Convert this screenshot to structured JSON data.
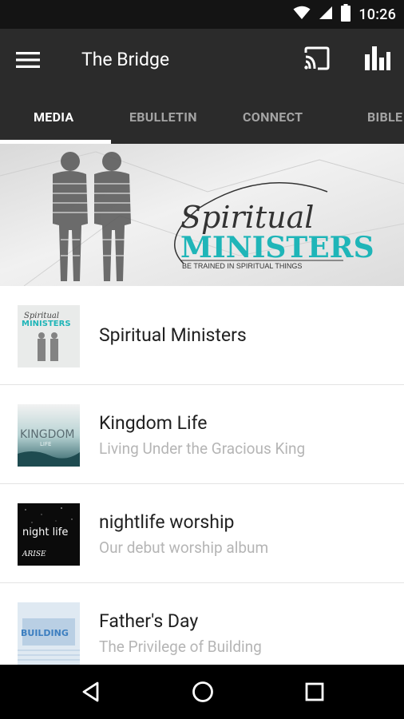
{
  "status_bar": {
    "time": "10:26",
    "icons": [
      "wifi-icon",
      "signal-icon",
      "battery-icon"
    ]
  },
  "app_bar": {
    "title": "The Bridge",
    "icons": [
      "menu-icon",
      "cast-icon",
      "bar-chart-icon"
    ]
  },
  "tabs": [
    {
      "label": "MEDIA",
      "active": true
    },
    {
      "label": "EBULLETIN",
      "active": false
    },
    {
      "label": "CONNECT",
      "active": false
    },
    {
      "label": "BIBLE",
      "active": false
    }
  ],
  "banner": {
    "script_word": "Spiritual",
    "headline": "MINISTERS",
    "tagline": "BE TRAINED IN SPIRITUAL THINGS"
  },
  "media_list": [
    {
      "title": "Spiritual Ministers",
      "subtitle": "",
      "thumb_text": "MINISTERS",
      "thumb_script": "Spiritual"
    },
    {
      "title": "Kingdom Life",
      "subtitle": "Living Under the Gracious King",
      "thumb_text": "KINGDOM",
      "thumb_sub": "LIFE"
    },
    {
      "title": "nightlife worship",
      "subtitle": "Our debut worship album",
      "thumb_text": "night life",
      "thumb_sub": "ARISE"
    },
    {
      "title": "Father's Day",
      "subtitle": "The Privilege of Building",
      "thumb_text": "BUILDING"
    }
  ],
  "nav_bar": {
    "icons": [
      "back-icon",
      "home-icon",
      "recents-icon"
    ]
  },
  "colors": {
    "app_bar": "#2b2b2b",
    "status_bar": "#141414",
    "accent_teal": "#1fb5b8",
    "subtitle_gray": "#b5b5b5"
  }
}
